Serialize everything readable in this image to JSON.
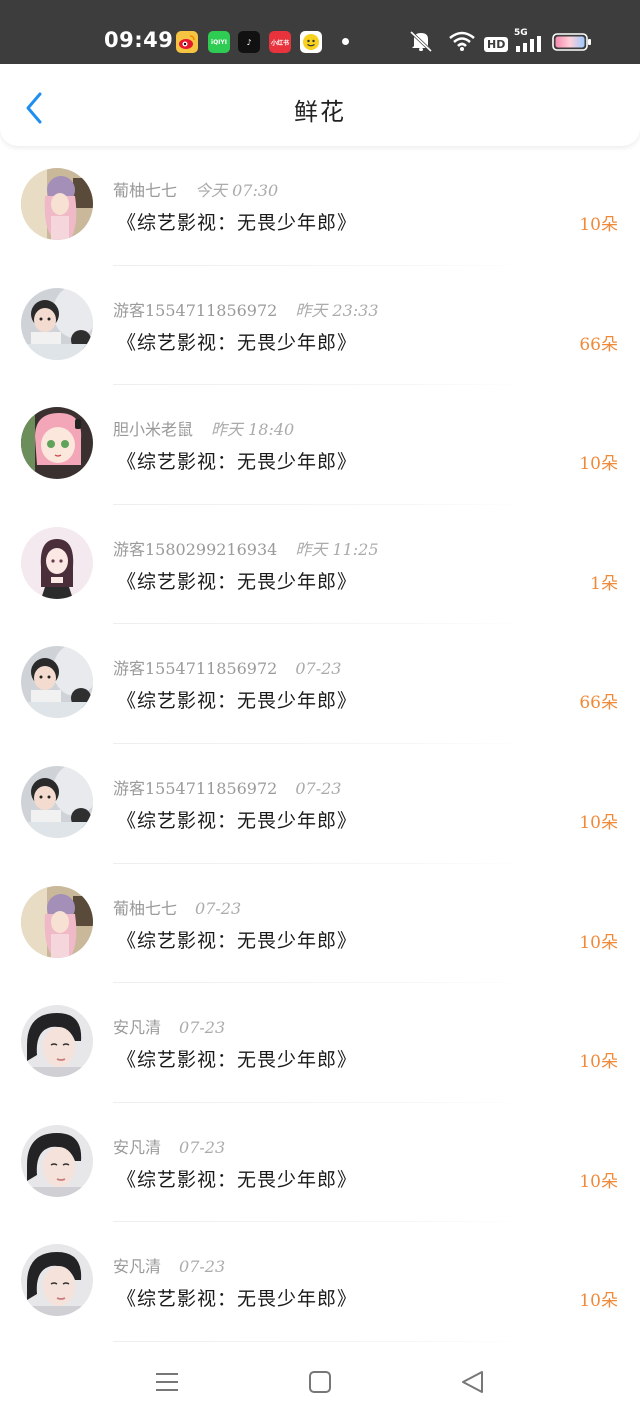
{
  "status_bar": {
    "time": "09:49",
    "apps": [
      {
        "name": "weibo",
        "glyph": "微"
      },
      {
        "name": "iqiyi",
        "glyph": "iQIYI"
      },
      {
        "name": "tiktok",
        "glyph": "♪"
      },
      {
        "name": "xiaohongshu",
        "glyph": "小红书"
      },
      {
        "name": "yellow-app",
        "glyph": ""
      }
    ],
    "network_label": "5G",
    "hd_label": "HD"
  },
  "header": {
    "title": "鲜花"
  },
  "records": [
    {
      "user": "葡柚七七",
      "time": "今天 07:30",
      "title": "《综艺影视：无畏少年郎》",
      "amount": "10朵",
      "avatar": "pink-hair-girl"
    },
    {
      "user": "游客1554711856972",
      "time": "昨天 23:33",
      "title": "《综艺影视：无畏少年郎》",
      "amount": "66朵",
      "avatar": "child-mirror"
    },
    {
      "user": "胆小米老鼠",
      "time": "昨天 18:40",
      "title": "《综艺影视：无畏少年郎》",
      "amount": "10朵",
      "avatar": "anime-pink-girl"
    },
    {
      "user": "游客1580299216934",
      "time": "昨天 11:25",
      "title": "《综艺影视：无畏少年郎》",
      "amount": "1朵",
      "avatar": "anime-dark-girl"
    },
    {
      "user": "游客1554711856972",
      "time": "07-23",
      "title": "《综艺影视：无畏少年郎》",
      "amount": "66朵",
      "avatar": "child-mirror"
    },
    {
      "user": "游客1554711856972",
      "time": "07-23",
      "title": "《综艺影视：无畏少年郎》",
      "amount": "10朵",
      "avatar": "child-mirror"
    },
    {
      "user": "葡柚七七",
      "time": "07-23",
      "title": "《综艺影视：无畏少年郎》",
      "amount": "10朵",
      "avatar": "pink-hair-girl"
    },
    {
      "user": "安凡清",
      "time": "07-23",
      "title": "《综艺影视：无畏少年郎》",
      "amount": "10朵",
      "avatar": "woman-portrait"
    },
    {
      "user": "安凡清",
      "time": "07-23",
      "title": "《综艺影视：无畏少年郎》",
      "amount": "10朵",
      "avatar": "woman-portrait"
    },
    {
      "user": "安凡清",
      "time": "07-23",
      "title": "《综艺影视：无畏少年郎》",
      "amount": "10朵",
      "avatar": "woman-portrait"
    }
  ],
  "nav": {
    "buttons": [
      "menu-icon",
      "home-icon",
      "back-triangle-icon"
    ]
  },
  "colors": {
    "accent": "#1f8ef1",
    "amount": "#f08a3a",
    "status_bar_bg": "#3d3d3d"
  }
}
